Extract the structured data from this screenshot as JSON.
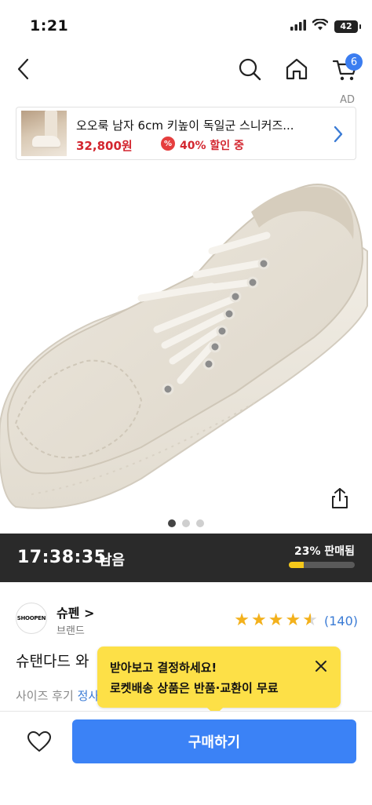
{
  "status": {
    "time": "1:21",
    "battery": "42"
  },
  "nav": {
    "cart_count": "6"
  },
  "ad": {
    "label": "AD",
    "title": "오오룩 남자 6cm 키높이 독일군 스니커즈...",
    "price": "32,800원",
    "discount_icon": "%",
    "discount": "40% 할인 중"
  },
  "gallery": {
    "total": 3,
    "active_index": 0
  },
  "timer": {
    "time": "17:38:35",
    "suffix": "남음",
    "sold_text": "23% 판매됨",
    "sold_fraction": 0.23
  },
  "brand": {
    "logo_text": "SHOOPEN",
    "name": "슈펜 >",
    "sub": "브랜드"
  },
  "rating": {
    "stars": 4.5,
    "review_count": "(140)"
  },
  "product": {
    "title": "슈탠다드 와",
    "size_review_label": "사이즈 후기",
    "size_review_link": "정사"
  },
  "tooltip": {
    "line1": "받아보고 결정하세요!",
    "line2": "로켓배송 상품은 반품·교환이 무료"
  },
  "actions": {
    "buy_label": "구매하기"
  },
  "colors": {
    "accent_blue": "#3b82f6",
    "price_red": "#d3262f",
    "star_gold": "#f3b11c",
    "tooltip_yellow": "#fde047",
    "timer_bg": "#2a2a2a",
    "progress_yellow": "#f5c81a"
  },
  "icons": {
    "back": "chevron-left-icon",
    "search": "search-icon",
    "home": "home-icon",
    "cart": "cart-icon",
    "share": "share-icon",
    "close": "close-icon",
    "heart": "heart-outline-icon"
  }
}
